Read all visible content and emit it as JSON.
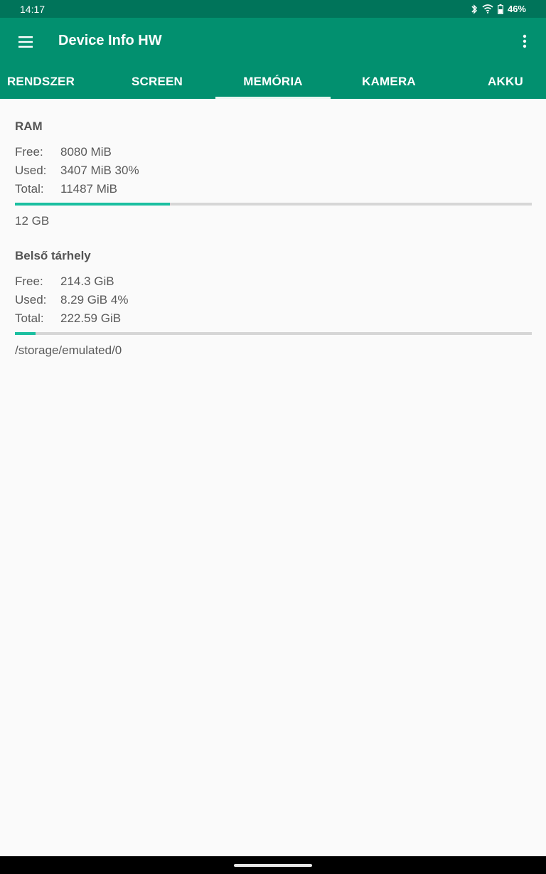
{
  "status": {
    "time": "14:17",
    "battery": "46%",
    "icons": [
      "bluetooth-icon",
      "wifi-icon",
      "battery-icon"
    ]
  },
  "appbar": {
    "title": "Device Info HW",
    "menu_icon": "hamburger-menu-icon",
    "more_icon": "more-vert-icon"
  },
  "tabs": [
    {
      "label": "RENDSZER",
      "active": false
    },
    {
      "label": "SCREEN",
      "active": false
    },
    {
      "label": "MEMÓRIA",
      "active": true
    },
    {
      "label": "KAMERA",
      "active": false
    },
    {
      "label": "AKKU",
      "active": false
    }
  ],
  "ram": {
    "title": "RAM",
    "free_label": "Free:",
    "free_value": "8080 MiB",
    "used_label": "Used:",
    "used_value": "3407 MiB 30%",
    "total_label": "Total:",
    "total_value": "11487 MiB",
    "usage_fraction": 0.3,
    "note": "12 GB"
  },
  "storage": {
    "title": "Belső tárhely",
    "free_label": "Free:",
    "free_value": "214.3 GiB",
    "used_label": "Used:",
    "used_value": "8.29 GiB 4%",
    "total_label": "Total:",
    "total_value": "222.59 GiB",
    "usage_fraction": 0.04,
    "note": "/storage/emulated/0"
  },
  "colors": {
    "status_bar": "#00745a",
    "app_bar": "#02906f",
    "progress": "#1bbfa0",
    "track": "#d6d6d6",
    "background": "#fafafa"
  }
}
